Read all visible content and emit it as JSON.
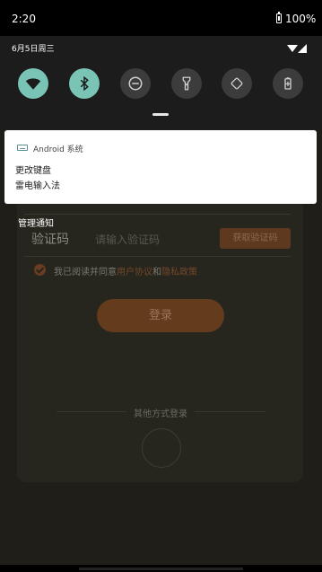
{
  "status_bar": {
    "time": "2:20",
    "battery": "100%"
  },
  "quick_settings": {
    "date": "6月5日周三",
    "tiles": [
      {
        "icon": "wifi-icon",
        "state": "on"
      },
      {
        "icon": "bluetooth-icon",
        "state": "on"
      },
      {
        "icon": "do-not-disturb-icon",
        "state": "off"
      },
      {
        "icon": "flashlight-icon",
        "state": "off"
      },
      {
        "icon": "auto-rotate-icon",
        "state": "off"
      },
      {
        "icon": "battery-saver-icon",
        "state": "off"
      }
    ],
    "colors": {
      "tile_on": "#79c4b5",
      "tile_off": "#3c3c3c"
    }
  },
  "notification": {
    "app_name": "Android 系统",
    "title": "更改键盘",
    "body": "雷电输入法",
    "icon": "keyboard-icon"
  },
  "manage_label": "管理通知",
  "app": {
    "code_label": "验证码",
    "code_placeholder": "请输入验证码",
    "get_code_button": "获取验证码",
    "agree_prefix": "我已阅读并同意",
    "user_agreement": "用户协议",
    "agree_and": "和",
    "privacy_policy": "隐私政策",
    "login_button": "登录",
    "other_login": "其他方式登录",
    "accent_color": "#e07a2f"
  }
}
